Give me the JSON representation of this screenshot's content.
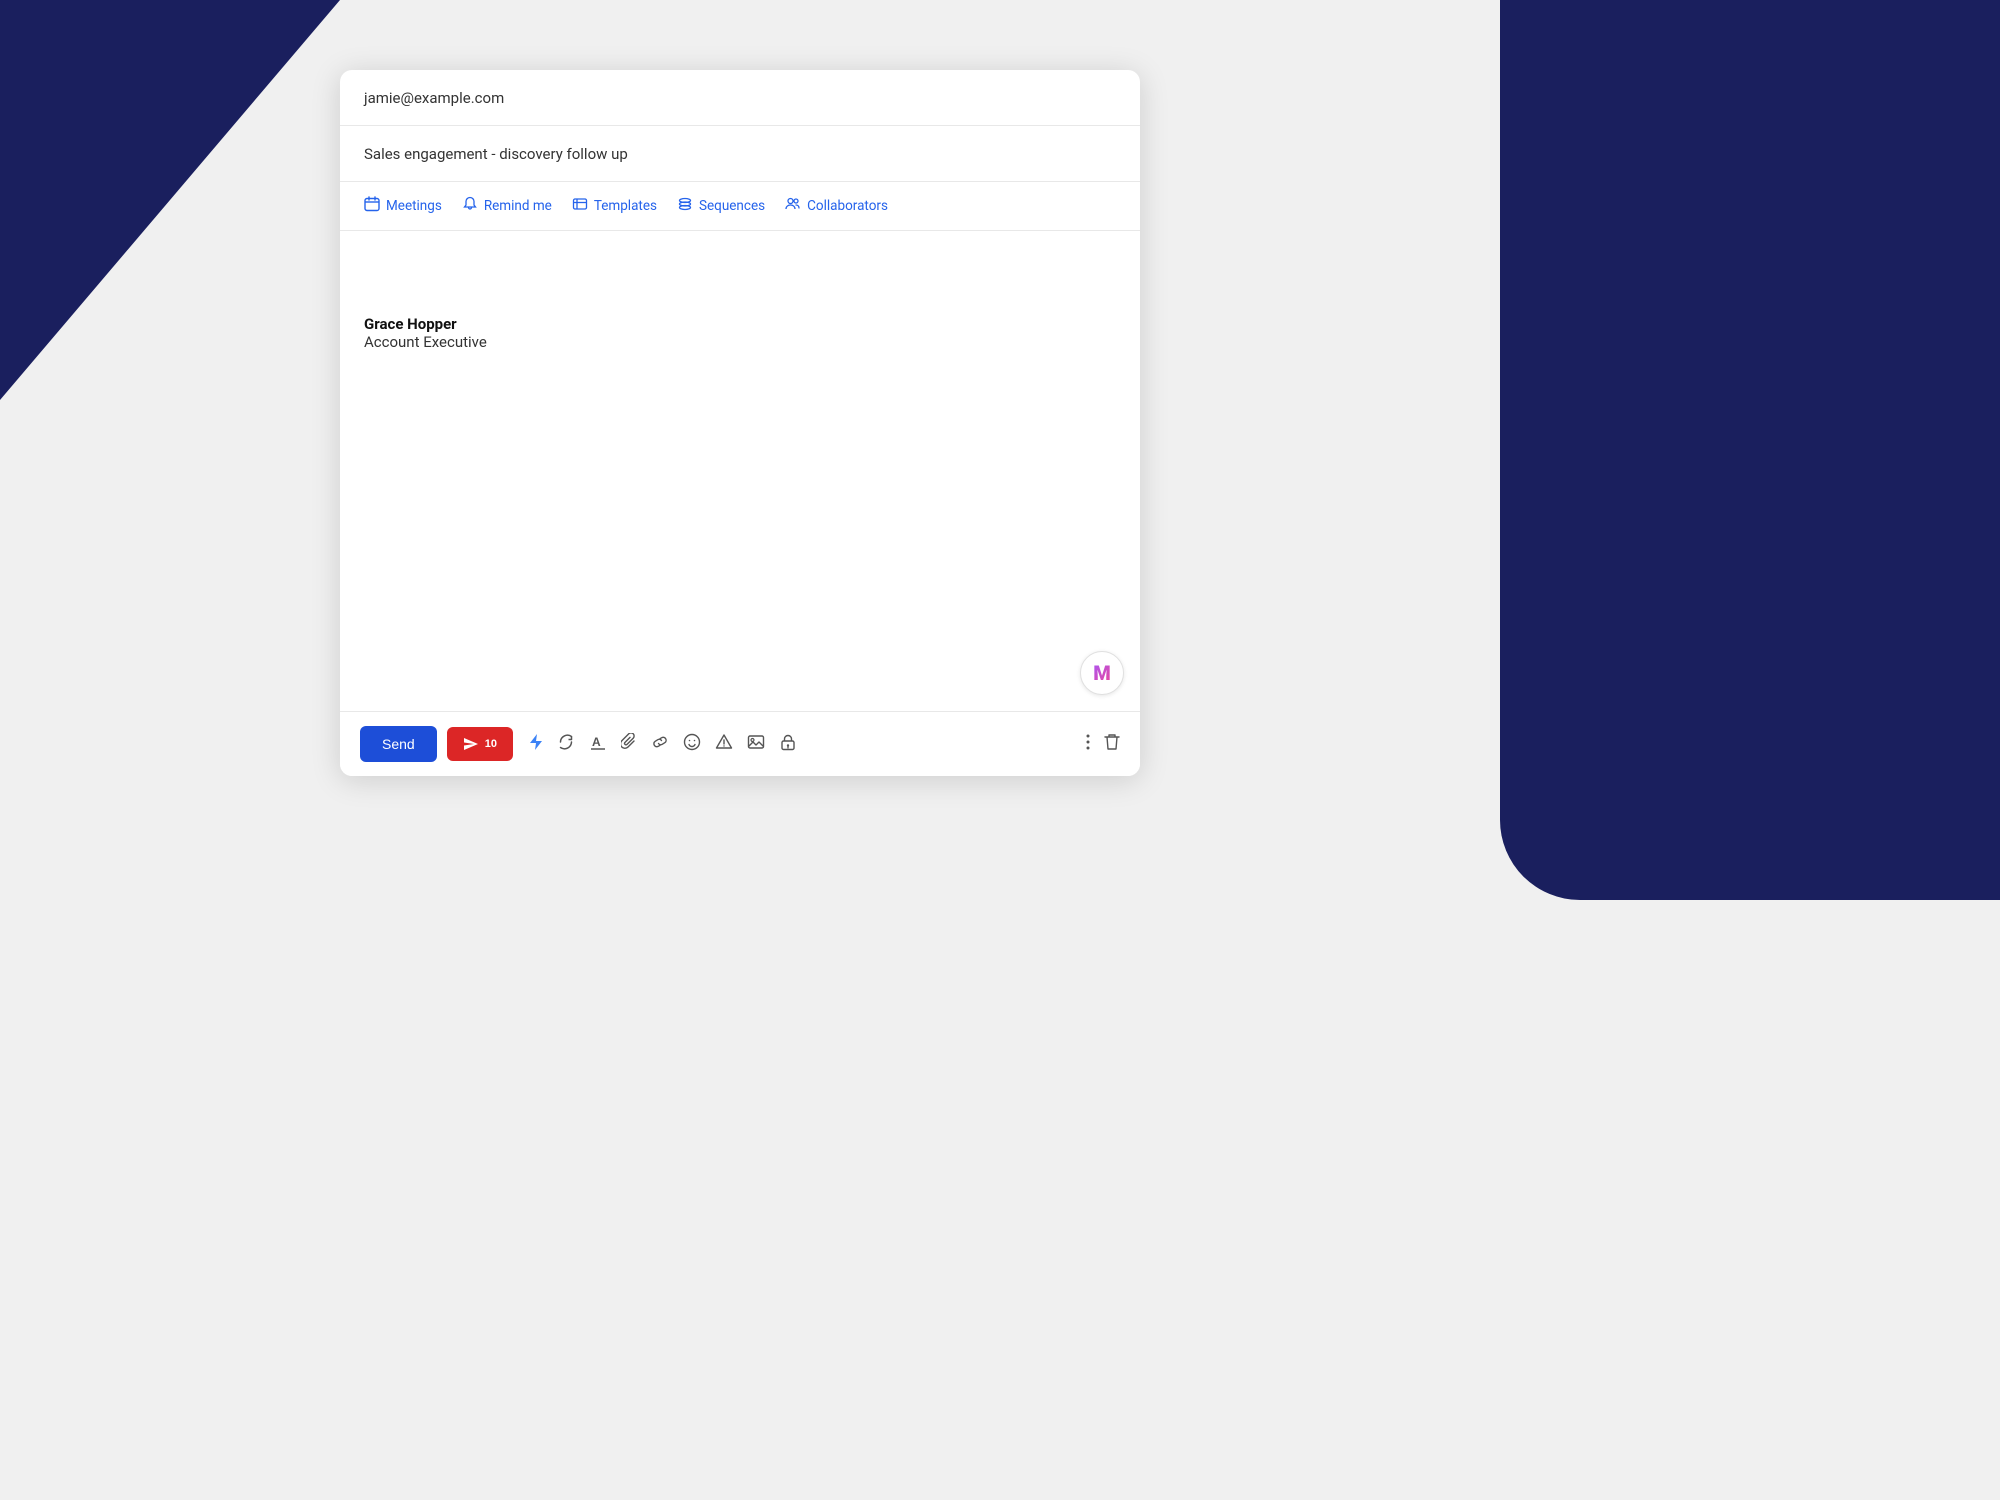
{
  "background": {
    "color": "#f0f0f0",
    "navy": "#1a1f5e"
  },
  "compose": {
    "to_label": "jamie@example.com",
    "subject_label": "Sales engagement - discovery follow up",
    "toolbar": {
      "meetings_label": "Meetings",
      "remind_me_label": "Remind me",
      "templates_label": "Templates",
      "sequences_label": "Sequences",
      "collaborators_label": "Collaborators"
    },
    "body": {
      "signature_name": "Grace Hopper",
      "signature_title": "Account Executive"
    },
    "footer": {
      "send_label": "Send",
      "track_number": "10",
      "more_options_label": "⋮",
      "delete_label": "🗑"
    }
  }
}
